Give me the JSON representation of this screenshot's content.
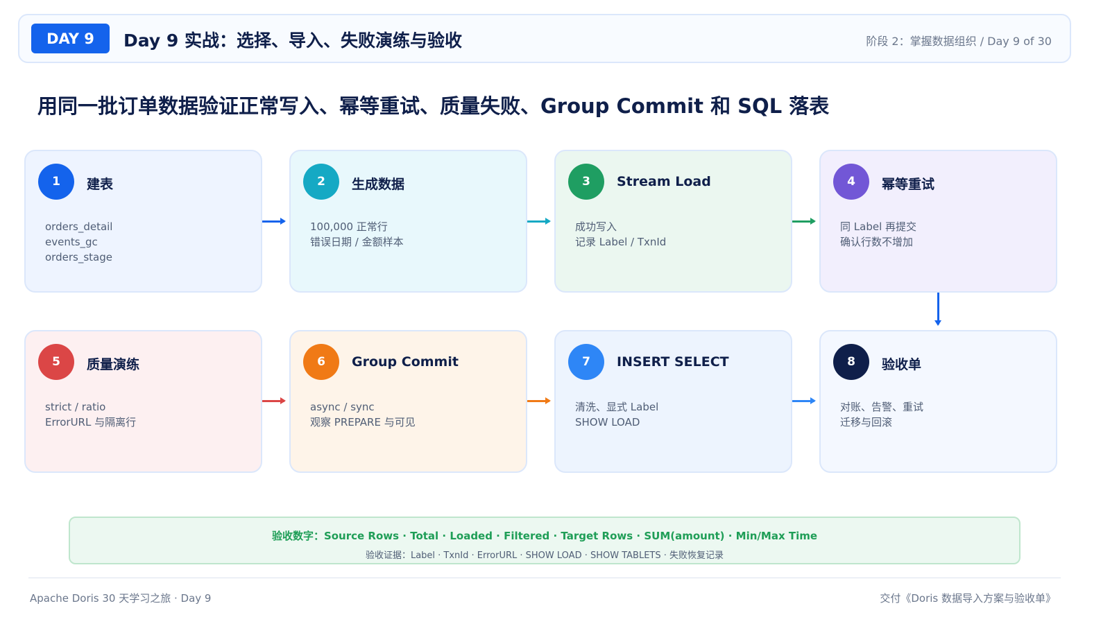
{
  "header": {
    "badge": "DAY 9",
    "title": "Day 9 实战：选择、导入、失败演练与验收",
    "meta": "阶段 2：掌握数据组织 / Day 9 of 30"
  },
  "subtitle": "用同一批订单数据验证正常写入、幂等重试、质量失败、Group Commit 和 SQL 落表",
  "steps": [
    {
      "num": "1",
      "title": "建表",
      "lines": [
        "orders_detail",
        "events_gc",
        "orders_stage"
      ],
      "color": "#1463ec",
      "bg": "#eef4ff"
    },
    {
      "num": "2",
      "title": "生成数据",
      "lines": [
        "100,000 正常行",
        "错误日期 / 金额样本"
      ],
      "color": "#15a9c4",
      "bg": "#e8f8fc"
    },
    {
      "num": "3",
      "title": "Stream Load",
      "lines": [
        "成功写入",
        "记录 Label / TxnId"
      ],
      "color": "#1f9e62",
      "bg": "#ebf7f0"
    },
    {
      "num": "4",
      "title": "幂等重试",
      "lines": [
        "同 Label 再提交",
        "确认行数不增加"
      ],
      "color": "#7257d6",
      "bg": "#f2effd"
    },
    {
      "num": "5",
      "title": "质量演练",
      "lines": [
        "strict / ratio",
        "ErrorURL 与隔离行"
      ],
      "color": "#db4646",
      "bg": "#fdf0f1"
    },
    {
      "num": "6",
      "title": "Group Commit",
      "lines": [
        "async / sync",
        "观察 PREPARE 与可见"
      ],
      "color": "#f07a16",
      "bg": "#fef4e9"
    },
    {
      "num": "7",
      "title": "INSERT SELECT",
      "lines": [
        "清洗、显式 Label",
        "SHOW LOAD"
      ],
      "color": "#2e86f6",
      "bg": "#edf4fe"
    },
    {
      "num": "8",
      "title": "验收单",
      "lines": [
        "对账、告警、重试",
        "迁移与回滚"
      ],
      "color": "#0f1f4a",
      "bg": "#f4f8ff"
    }
  ],
  "acceptance": {
    "primary": "验收数字：Source Rows · Total · Loaded · Filtered · Target Rows · SUM(amount) · Min/Max Time",
    "secondary": "验收证据：Label · TxnId · ErrorURL · SHOW LOAD · SHOW TABLETS · 失败恢复记录"
  },
  "footer": {
    "left": "Apache Doris 30 天学习之旅 · Day 9",
    "right": "交付《Doris 数据导入方案与验收单》"
  }
}
